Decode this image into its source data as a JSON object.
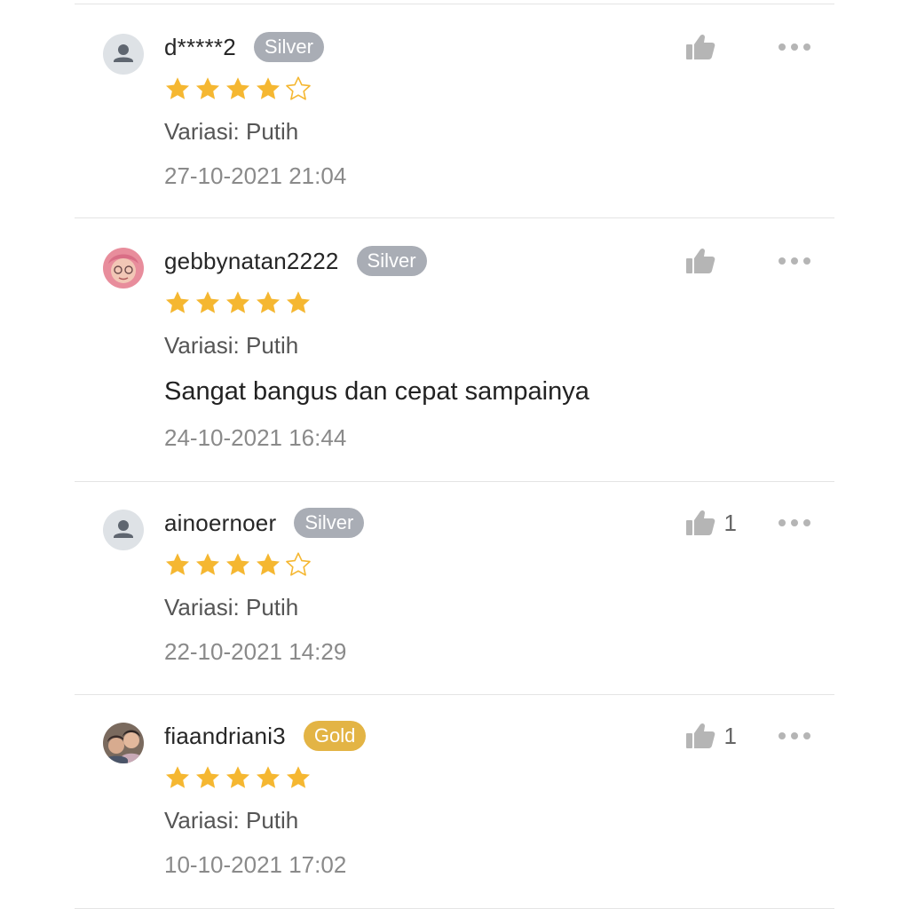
{
  "reviews": [
    {
      "username": "d*****2",
      "badge": "Silver",
      "badge_color": "#a9adb5",
      "rating": 4,
      "max_rating": 5,
      "variation": "Variasi: Putih",
      "comment": "",
      "timestamp": "27-10-2021 21:04",
      "likes": "",
      "avatar": "default-user-icon"
    },
    {
      "username": "gebbynatan2222",
      "badge": "Silver",
      "badge_color": "#a9adb5",
      "rating": 5,
      "max_rating": 5,
      "variation": "Variasi: Putih",
      "comment": "Sangat bangus dan cepat sampainya",
      "timestamp": "24-10-2021 16:44",
      "likes": "",
      "avatar": "photo"
    },
    {
      "username": "ainoernoer",
      "badge": "Silver",
      "badge_color": "#a9adb5",
      "rating": 4,
      "max_rating": 5,
      "variation": "Variasi: Putih",
      "comment": "",
      "timestamp": "22-10-2021 14:29",
      "likes": "1",
      "avatar": "default-user-icon"
    },
    {
      "username": "fiaandriani3",
      "badge": "Gold",
      "badge_color": "#e3b445",
      "rating": 5,
      "max_rating": 5,
      "variation": "Variasi: Putih",
      "comment": "",
      "timestamp": "10-10-2021 17:02",
      "likes": "1",
      "avatar": "photo"
    }
  ],
  "colors": {
    "star": "#f5b731",
    "star_outline": "#f5b731",
    "icon_gray": "#b5b5b5"
  },
  "icons": {
    "like": "thumbs-up-icon",
    "more": "more-dots-icon",
    "star": "star-icon"
  }
}
